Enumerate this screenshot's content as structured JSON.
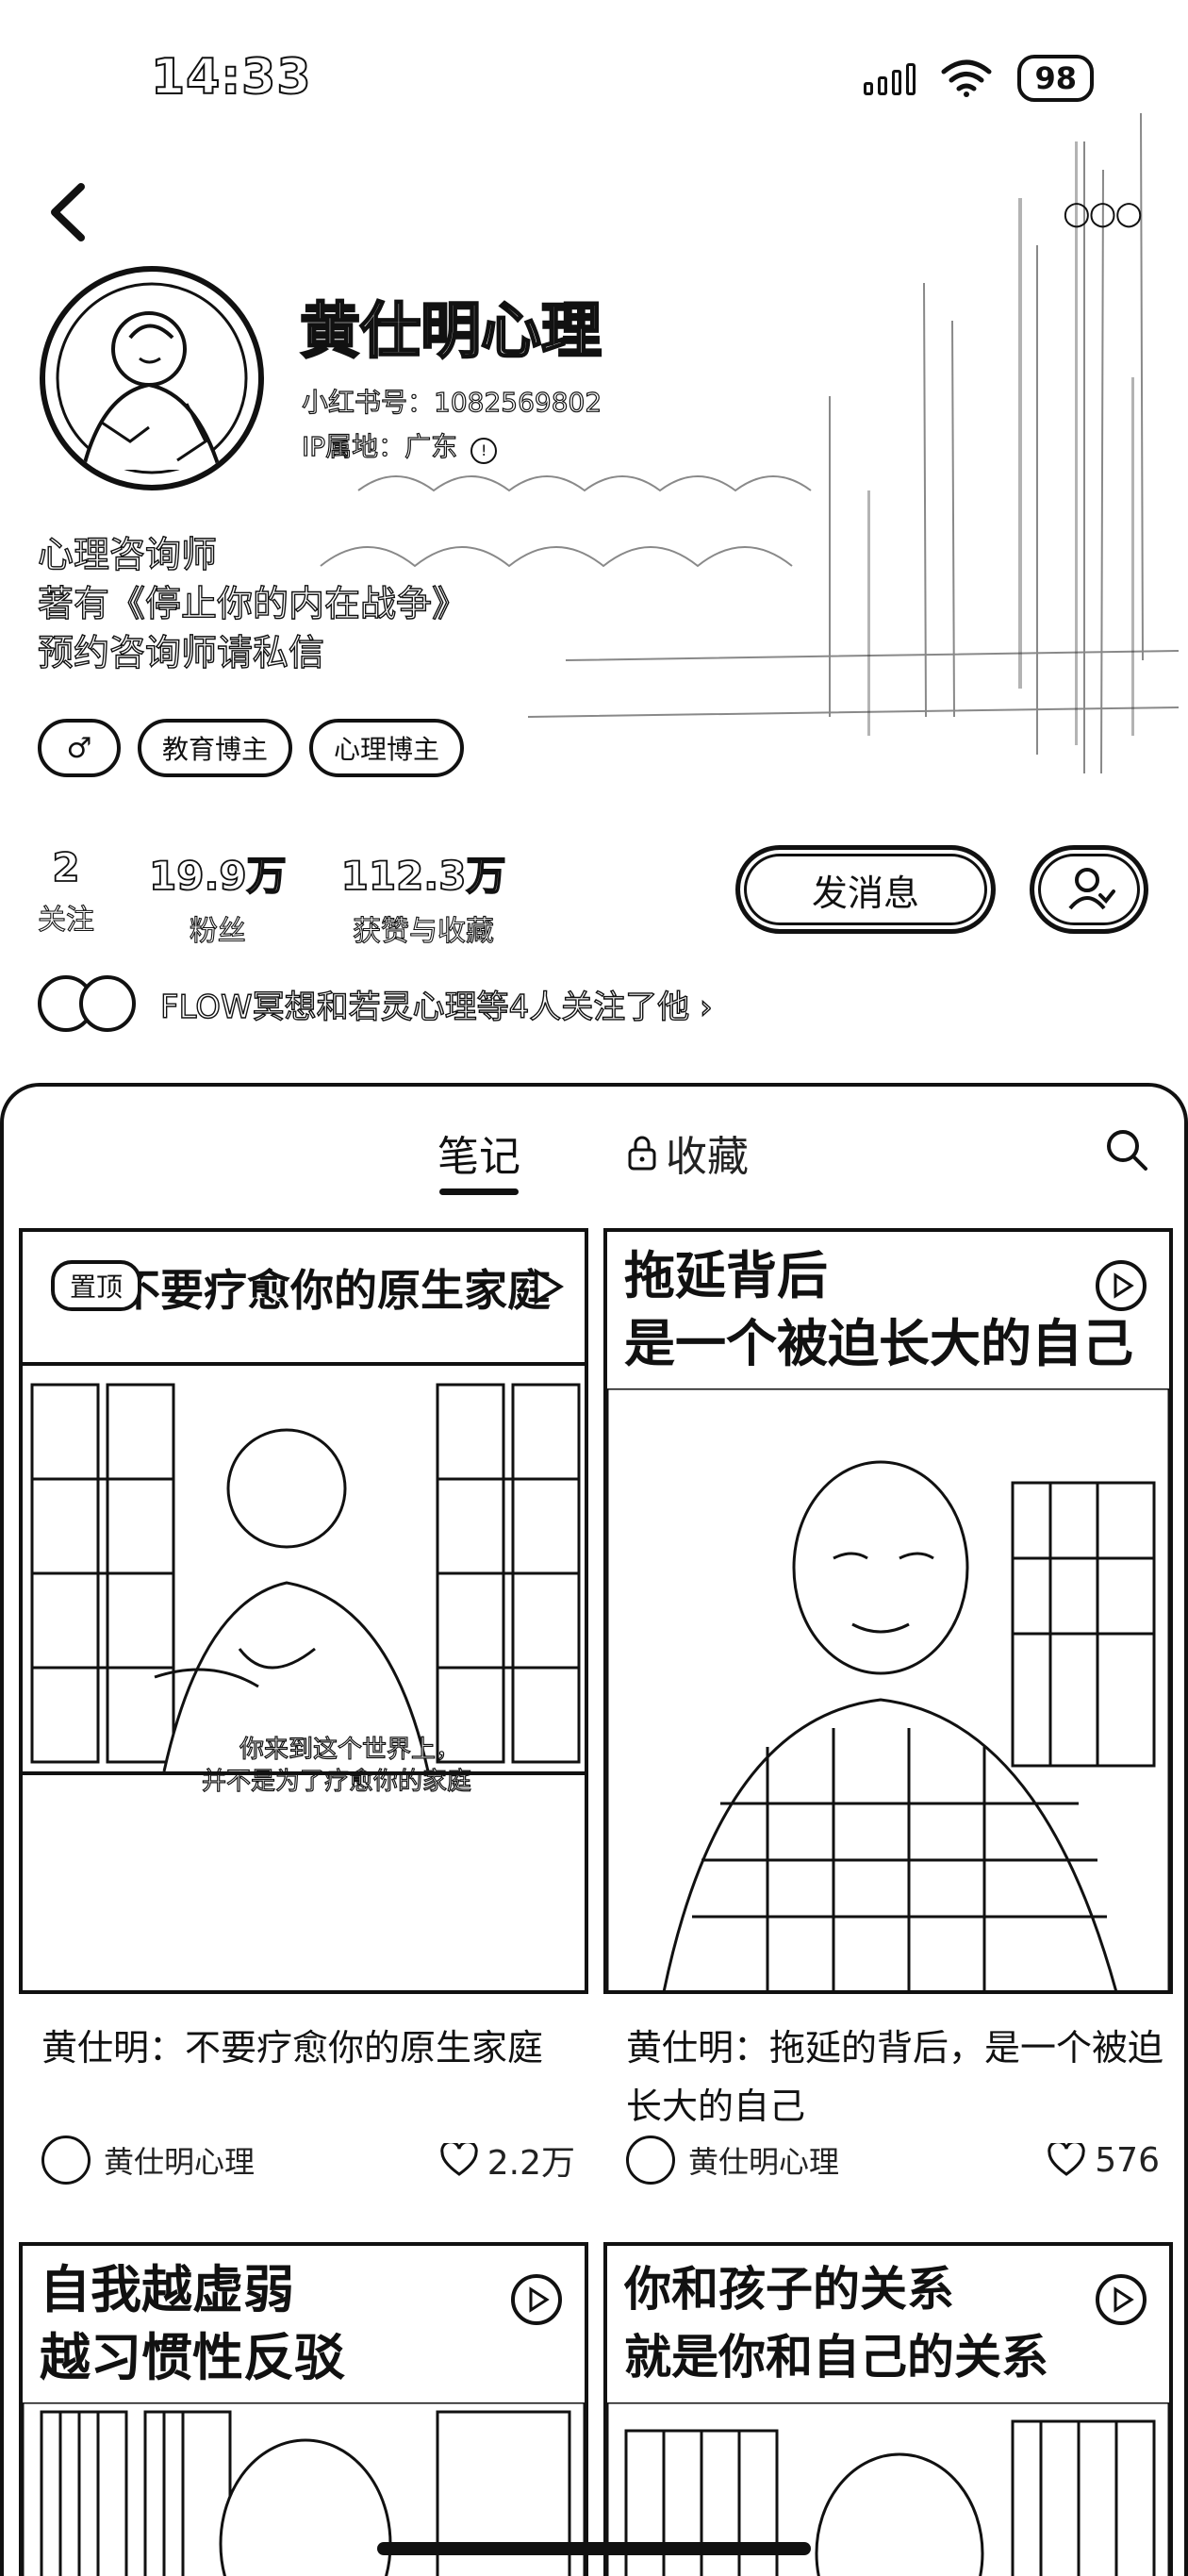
{
  "status_bar": {
    "time": "14:33",
    "battery": "98"
  },
  "profile": {
    "name": "黄仕明心理",
    "id_text": "小红书号：1082569802",
    "ip_text": "IP属地：广东",
    "bio_lines": [
      "心理咨询师",
      "著有《停止你的内在战争》",
      "预约咨询师请私信"
    ],
    "tags": [
      {
        "label": "♂"
      },
      {
        "label": "教育博主"
      },
      {
        "label": "心理博主"
      }
    ]
  },
  "stats": [
    {
      "value": "2",
      "label": "关注"
    },
    {
      "value": "19.9万",
      "label": "粉丝"
    },
    {
      "value": "112.3万",
      "label": "获赞与收藏"
    }
  ],
  "actions": {
    "message_label": "发消息"
  },
  "mutuals": {
    "text": "FLOW冥想和若灵心理等4人关注了他 ›"
  },
  "tabs": {
    "notes": "笔记",
    "saved": "收藏"
  },
  "cards": [
    {
      "cover_title": "不要疗愈你的原生家庭",
      "pin_label": "置顶",
      "subtitle_line1": "你来到这个世界上，",
      "subtitle_line2": "并不是为了疗愈你的家庭",
      "caption": "黄仕明：不要疗愈你的原生家庭",
      "author": "黄仕明心理",
      "likes": "2.2万"
    },
    {
      "cover_title_line1": "拖延背后",
      "cover_title_line2": "是一个被迫长大的自己",
      "caption": "黄仕明：拖延的背后，是一个被迫长大的自己",
      "author": "黄仕明心理",
      "likes": "576"
    },
    {
      "cover_title_line1": "自我越虚弱",
      "cover_title_line2": "越习惯性反驳"
    },
    {
      "cover_title_line1": "你和孩子的关系",
      "cover_title_line2": "就是你和自己的关系"
    }
  ]
}
